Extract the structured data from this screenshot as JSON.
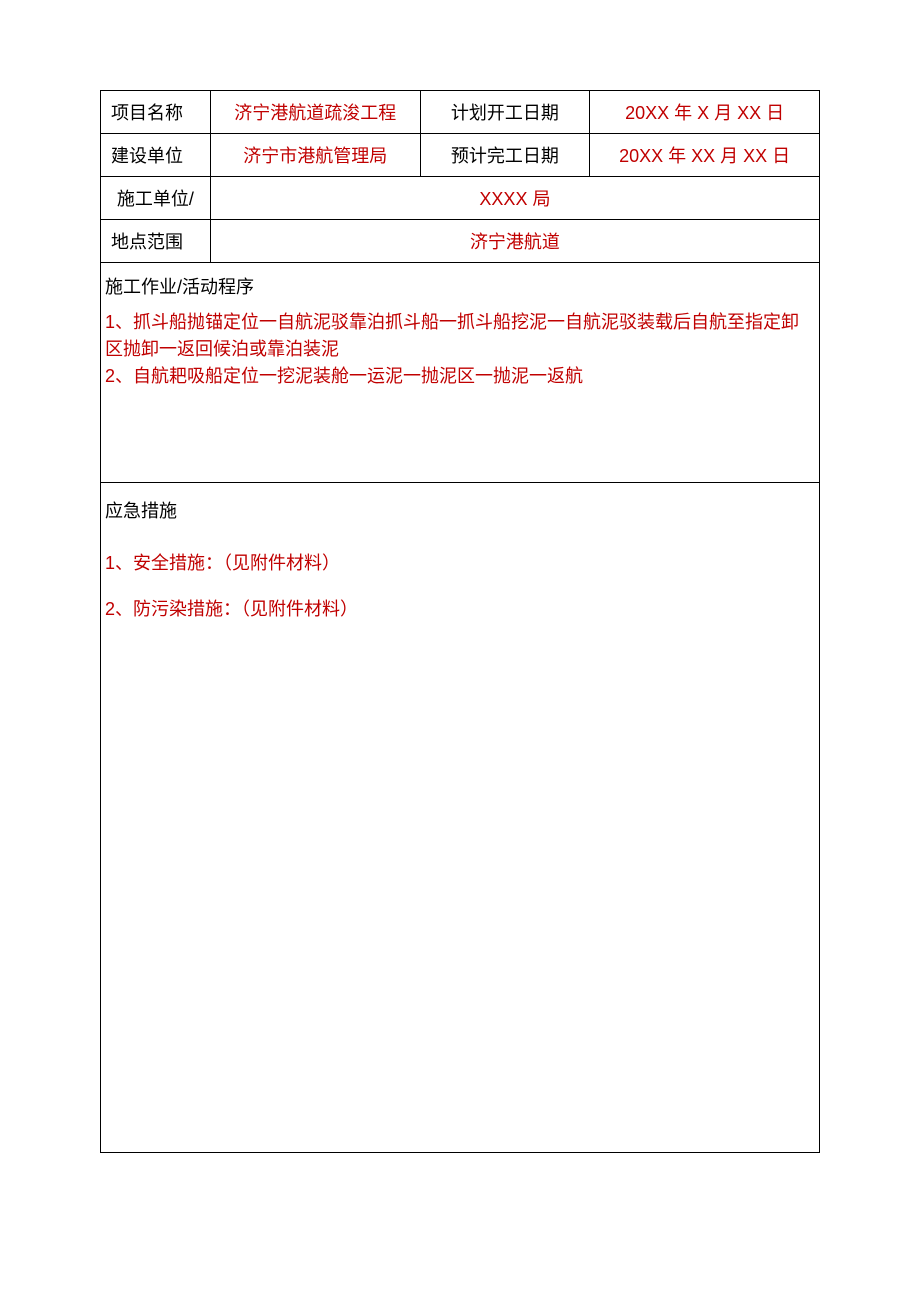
{
  "form": {
    "row1": {
      "label1": "项目名称",
      "value1": "济宁港航道疏浚工程",
      "label2": "计划开工日期",
      "value2": "20XX 年 X 月 XX 日"
    },
    "row2": {
      "label1": "建设单位",
      "value1": "济宁市港航管理局",
      "label2": "预计完工日期",
      "value2": "20XX 年 XX 月 XX 日"
    },
    "row3": {
      "label": "施工单位/",
      "value": "XXXX 局"
    },
    "row4": {
      "label": "地点范围",
      "value": "济宁港航道"
    }
  },
  "procedure": {
    "header": "施工作业/活动程序",
    "line1": "1、抓斗船抛锚定位一自航泥驳靠泊抓斗船一抓斗船挖泥一自航泥驳装载后自航至指定卸区抛卸一返回候泊或靠泊装泥",
    "line2": "2、自航耙吸船定位一挖泥装舱一运泥一抛泥区一抛泥一返航"
  },
  "emergency": {
    "header": "应急措施",
    "item1": "1、安全措施：（见附件材料）",
    "item2": "2、防污染措施：（见附件材料）"
  }
}
